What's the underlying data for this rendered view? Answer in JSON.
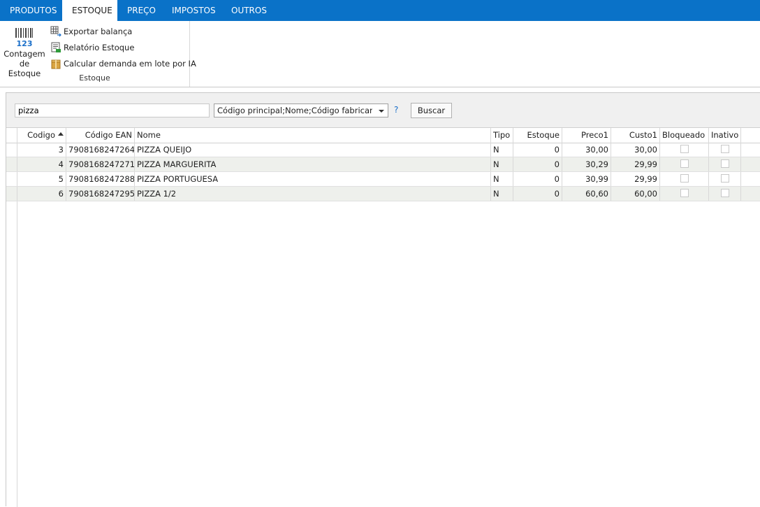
{
  "ribbon": {
    "tabs": [
      {
        "label": "PRODUTOS",
        "active": false
      },
      {
        "label": "ESTOQUE",
        "active": true
      },
      {
        "label": "PREÇO",
        "active": false
      },
      {
        "label": "IMPOSTOS",
        "active": false
      },
      {
        "label": "OUTROS",
        "active": false
      }
    ],
    "group_label": "Estoque",
    "big_button": {
      "line1": "Contagem",
      "line2": "de Estoque",
      "icon": "barcode-123-icon",
      "icon_digits": "123"
    },
    "small_buttons": [
      {
        "label": "Exportar balança",
        "icon": "grid-export-icon"
      },
      {
        "label": "Relatório Estoque",
        "icon": "report-icon"
      },
      {
        "label": "Calcular demanda em lote por IA",
        "icon": "box-icon"
      }
    ]
  },
  "search": {
    "value": "pizza",
    "fields": "Código principal;Nome;Código fabricant...",
    "help": "?",
    "button": "Buscar"
  },
  "grid": {
    "columns": [
      "Codigo",
      "Código EAN",
      "Nome",
      "Tipo",
      "Estoque",
      "Preco1",
      "Custo1",
      "Bloqueado",
      "Inativo"
    ],
    "sorted_column": "Codigo",
    "rows": [
      {
        "codigo": "3",
        "ean": "7908168247264",
        "nome": "PIZZA QUEIJO",
        "tipo": "N",
        "estoque": "0",
        "preco1": "30,00",
        "custo1": "30,00",
        "bloqueado": false,
        "inativo": false
      },
      {
        "codigo": "4",
        "ean": "7908168247271",
        "nome": "PIZZA MARGUERITA",
        "tipo": "N",
        "estoque": "0",
        "preco1": "30,29",
        "custo1": "29,99",
        "bloqueado": false,
        "inativo": false
      },
      {
        "codigo": "5",
        "ean": "7908168247288",
        "nome": "PIZZA PORTUGUESA",
        "tipo": "N",
        "estoque": "0",
        "preco1": "30,99",
        "custo1": "29,99",
        "bloqueado": false,
        "inativo": false
      },
      {
        "codigo": "6",
        "ean": "7908168247295",
        "nome": "PIZZA 1/2",
        "tipo": "N",
        "estoque": "0",
        "preco1": "60,60",
        "custo1": "60,00",
        "bloqueado": false,
        "inativo": false
      }
    ]
  },
  "colors": {
    "tab_bar": "#0a72c8",
    "alt_row": "#eef0ec",
    "panel": "#f0f0f0",
    "help": "#1a6fc9"
  }
}
